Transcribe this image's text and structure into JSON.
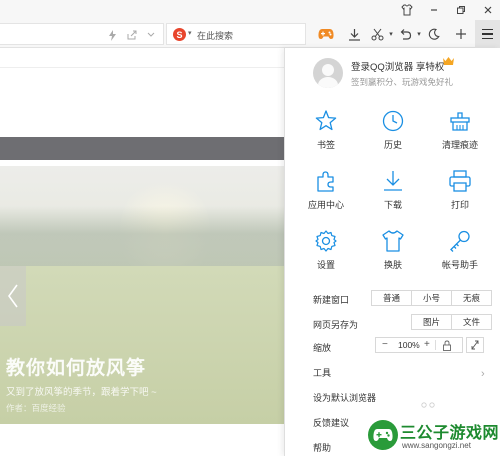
{
  "toolbar": {
    "search_placeholder": "在此搜索",
    "search_engine_letter": "S"
  },
  "page": {
    "article_title": "教你如何放风筝",
    "article_subtitle": "又到了放风筝的季节，跟着学下吧 ~",
    "article_author": "作者：百度经验"
  },
  "menu": {
    "login_text": "登录QQ浏览器 享特权",
    "login_subtext": "签到赢积分、玩游戏免好礼",
    "grid": [
      {
        "label": "书签",
        "icon": "star-icon"
      },
      {
        "label": "历史",
        "icon": "clock-icon"
      },
      {
        "label": "清理痕迹",
        "icon": "trash-icon"
      },
      {
        "label": "应用中心",
        "icon": "puzzle-icon"
      },
      {
        "label": "下载",
        "icon": "download-icon"
      },
      {
        "label": "打印",
        "icon": "printer-icon"
      },
      {
        "label": "设置",
        "icon": "gear-icon"
      },
      {
        "label": "换肤",
        "icon": "shirt-icon"
      },
      {
        "label": "帐号助手",
        "icon": "key-icon"
      }
    ],
    "new_window_label": "新建窗口",
    "new_window_options": [
      "普通",
      "小号",
      "无痕"
    ],
    "save_page_label": "网页另存为",
    "save_page_options": [
      "图片",
      "文件"
    ],
    "zoom_label": "缩放",
    "zoom_minus": "−",
    "zoom_value": "100%",
    "zoom_plus": "+",
    "tools_label": "工具",
    "set_default_label": "设为默认浏览器",
    "feedback_label": "反馈建议",
    "help_label": "帮助"
  },
  "watermark": {
    "title": "三公子游戏网",
    "url": "www.sangongzi.net"
  },
  "colors": {
    "accent_blue": "#1a8fe3",
    "crown_orange": "#f5a623"
  }
}
